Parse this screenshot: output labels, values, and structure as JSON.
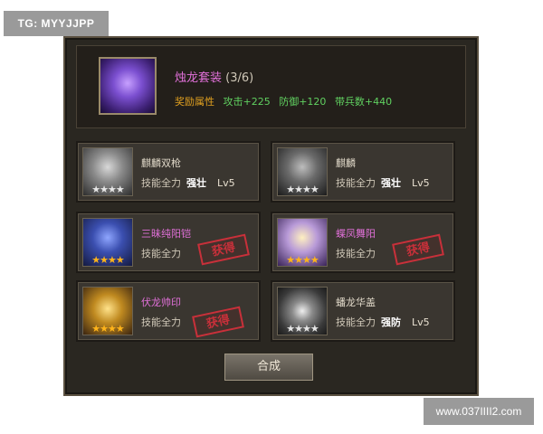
{
  "watermark_top": "TG: MYYJJPP",
  "watermark_bottom": "www.037IIII2.com",
  "set": {
    "name": "烛龙套装",
    "count": "(3/6)",
    "attr_label": "奖励属性",
    "attrs": [
      "攻击+225",
      "防御+120",
      "带兵数+440"
    ]
  },
  "cards": [
    {
      "name": "麒麟双枪",
      "skill_label": "技能全力",
      "skill": "强壮",
      "level": "Lv5",
      "stars": "★★★★",
      "star_color": "silver",
      "stamp": ""
    },
    {
      "name": "麒麟",
      "skill_label": "技能全力",
      "skill": "强壮",
      "level": "Lv5",
      "stars": "★★★★",
      "star_color": "silver",
      "stamp": ""
    },
    {
      "name": "三昧纯阳铠",
      "skill_label": "技能全力",
      "skill": "",
      "level": "",
      "stars": "★★★★",
      "star_color": "gold",
      "stamp": "获得"
    },
    {
      "name": "蝶凤舞阳",
      "skill_label": "技能全力",
      "skill": "",
      "level": "",
      "stars": "★★★★",
      "star_color": "gold",
      "stamp": "获得"
    },
    {
      "name": "伏龙帅印",
      "skill_label": "技能全力",
      "skill": "",
      "level": "",
      "stars": "★★★★",
      "star_color": "gold",
      "stamp": "获得"
    },
    {
      "name": "蟠龙华盖",
      "skill_label": "技能全力",
      "skill": "强防",
      "level": "Lv5",
      "stars": "★★★★",
      "star_color": "silver",
      "stamp": ""
    }
  ],
  "synth_button": "合成"
}
